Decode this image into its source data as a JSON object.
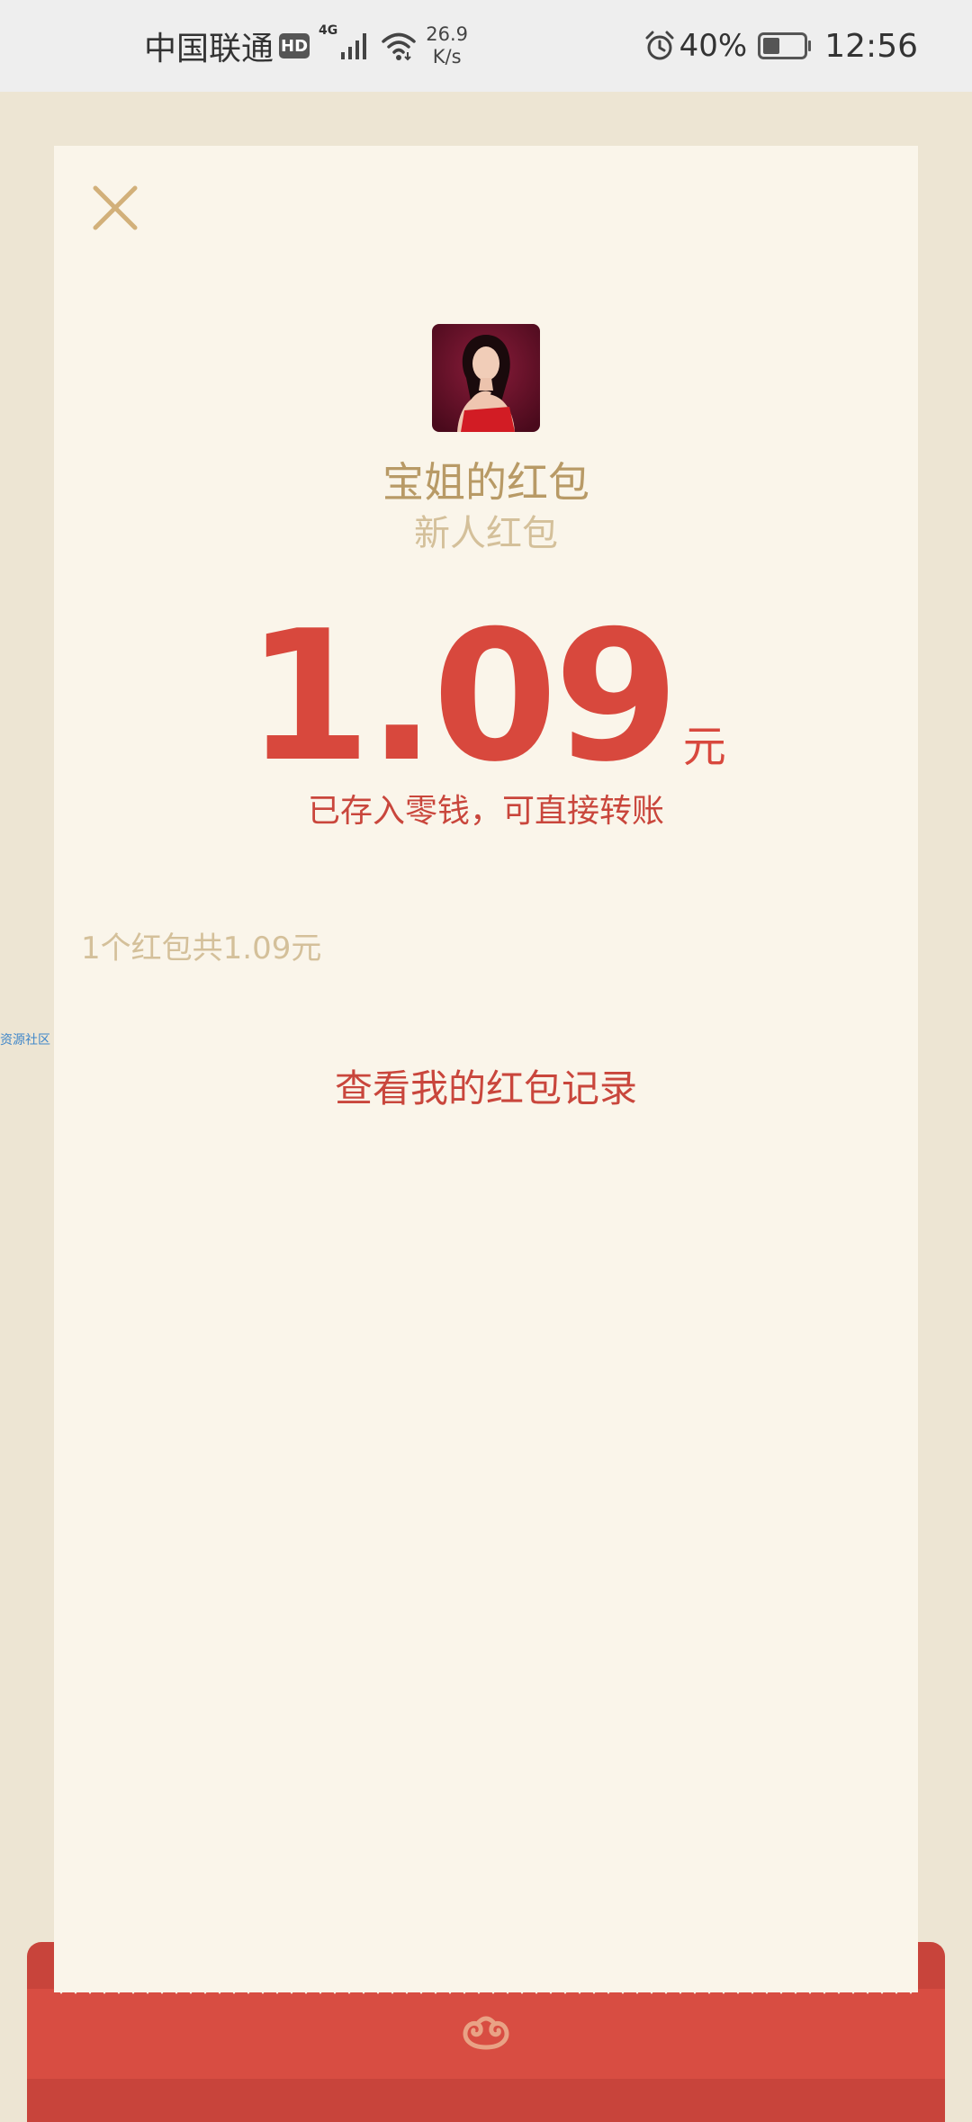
{
  "status_bar": {
    "carrier": "中国联通",
    "hd_badge": "HD",
    "network_type": "4G",
    "speed_value": "26.9",
    "speed_unit": "K/s",
    "battery": "40%",
    "time": "12:56"
  },
  "watermark": {
    "text": "资源社区"
  },
  "packet": {
    "sender_title": "宝姐的红包",
    "greeting": "新人红包",
    "amount": "1.09",
    "currency": "元",
    "deposit_note": "已存入零钱，可直接转账",
    "summary": "1个红包共1.09元",
    "record_link": "查看我的红包记录"
  },
  "colors": {
    "accent_red": "#d8483d",
    "gold": "#b89a66",
    "light_gold": "#d4c09a",
    "card_bg": "#faf5ea",
    "page_bg": "#ede5d3"
  }
}
